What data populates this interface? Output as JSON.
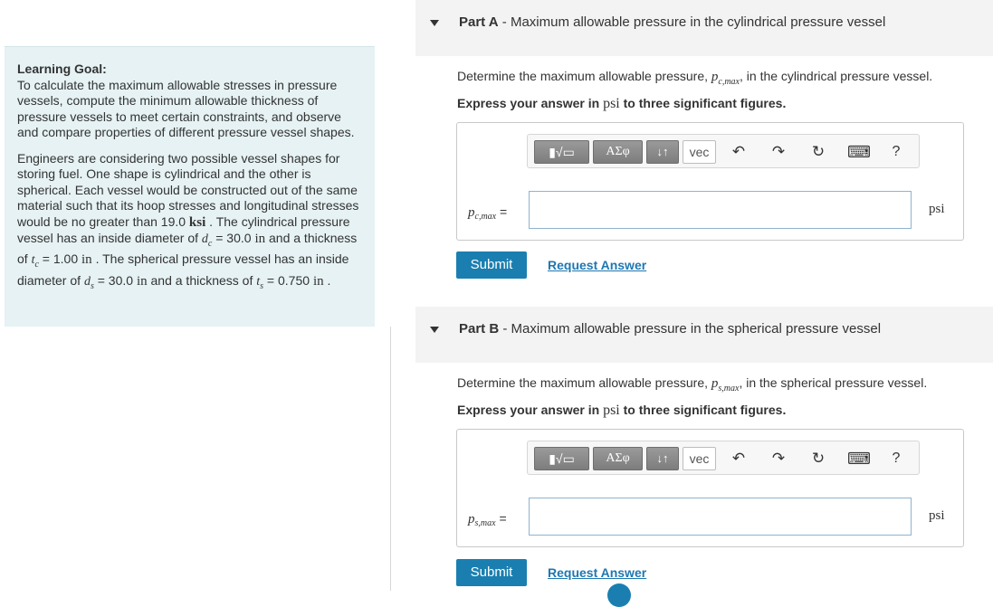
{
  "learning_goal": {
    "title": "Learning Goal:",
    "text": "To calculate the maximum allowable stresses in pressure vessels, compute the minimum allowable thickness of pressure vessels to meet certain constraints, and observe and compare properties of different pressure vessel shapes.",
    "scenario": {
      "s1": "Engineers are considering two possible vessel shapes for storing fuel. One shape is cylindrical and the other is spherical. Each vessel would be constructed out of the same material such that its hoop stresses and longitudinal stresses would be no greater than 19.0 ",
      "unit_ksi": "ksi",
      "s2": " . The cylindrical pressure vessel has an inside diameter of ",
      "dc_sym": "d",
      "dc_sub": "c",
      "dc_eq": " = 30.0 ",
      "unit_in1": "in",
      "s3": " and a thickness of ",
      "tc_sym": "t",
      "tc_sub": "c",
      "tc_eq": " = 1.00 ",
      "unit_in2": "in",
      "s4": " . The spherical pressure vessel has an inside diameter of ",
      "ds_sym": "d",
      "ds_sub": "s",
      "ds_eq": " = 30.0 ",
      "unit_in3": "in",
      "s5": " and a thickness of ",
      "ts_sym": "t",
      "ts_sub": "s",
      "ts_eq": " = 0.750 ",
      "unit_in4": "in",
      "s6": " ."
    }
  },
  "parts": [
    {
      "label": "Part A",
      "title": " - Maximum allowable pressure in the cylindrical pressure vessel",
      "question_pre": "Determine the maximum allowable pressure, ",
      "var_main": "p",
      "var_sub": "c,max",
      "question_post": ", in the cylindrical pressure vessel.",
      "instr_pre": "Express your answer in ",
      "instr_unit": "psi",
      "instr_post": " to three significant figures.",
      "input_label_eq": " =",
      "input_value": "",
      "unit": "psi",
      "submit": "Submit",
      "request": "Request Answer"
    },
    {
      "label": "Part B",
      "title": " - Maximum allowable pressure in the spherical pressure vessel",
      "question_pre": "Determine the maximum allowable pressure, ",
      "var_main": "p",
      "var_sub": "s,max",
      "question_post": ", in the spherical pressure vessel.",
      "instr_pre": "Express your answer in ",
      "instr_unit": "psi",
      "instr_post": " to three significant figures.",
      "input_label_eq": " =",
      "input_value": "",
      "unit": "psi",
      "submit": "Submit",
      "request": "Request Answer"
    }
  ],
  "toolbar": {
    "template_label": "▮√▭",
    "greek_label": "ΑΣφ",
    "arrows_label": "↓↑",
    "vec_label": "vec",
    "undo": "↶",
    "redo": "↷",
    "reset": "↻",
    "keyboard": "⌨",
    "help": "?"
  },
  "colors": {
    "goal_bg": "#e6f2f4",
    "header_bg": "#f3f3f3",
    "submit_bg": "#1a7fb0",
    "link": "#1e77b1"
  }
}
